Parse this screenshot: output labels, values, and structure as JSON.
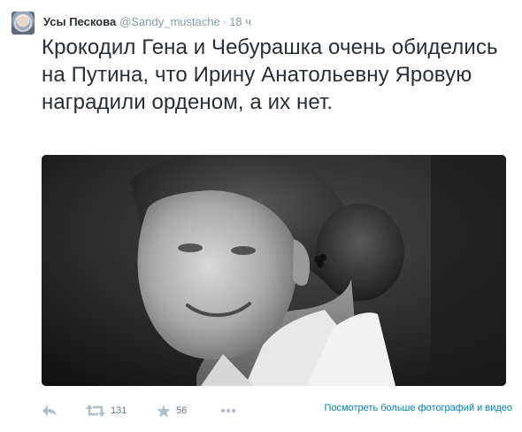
{
  "tweet": {
    "fullname": "Усы Пескова",
    "handle": "@Sandy_mustache",
    "separator": "·",
    "time": "18 ч",
    "text": "Крокодил Гена и Чебурашка очень обиделись на Путина, что Ирину Анатольевну Яровую наградили орденом, а их нет."
  },
  "actions": {
    "reply_icon": "reply-icon",
    "retweet_icon": "retweet-icon",
    "retweet_count": "131",
    "favorite_icon": "star-icon",
    "favorite_count": "56",
    "more_icon": "more-icon",
    "media_link": "Посмотреть больше фотографий и видео"
  },
  "colors": {
    "text": "#292f33",
    "muted": "#8899a6",
    "link": "#0084b4",
    "icon": "#b0bec8"
  }
}
